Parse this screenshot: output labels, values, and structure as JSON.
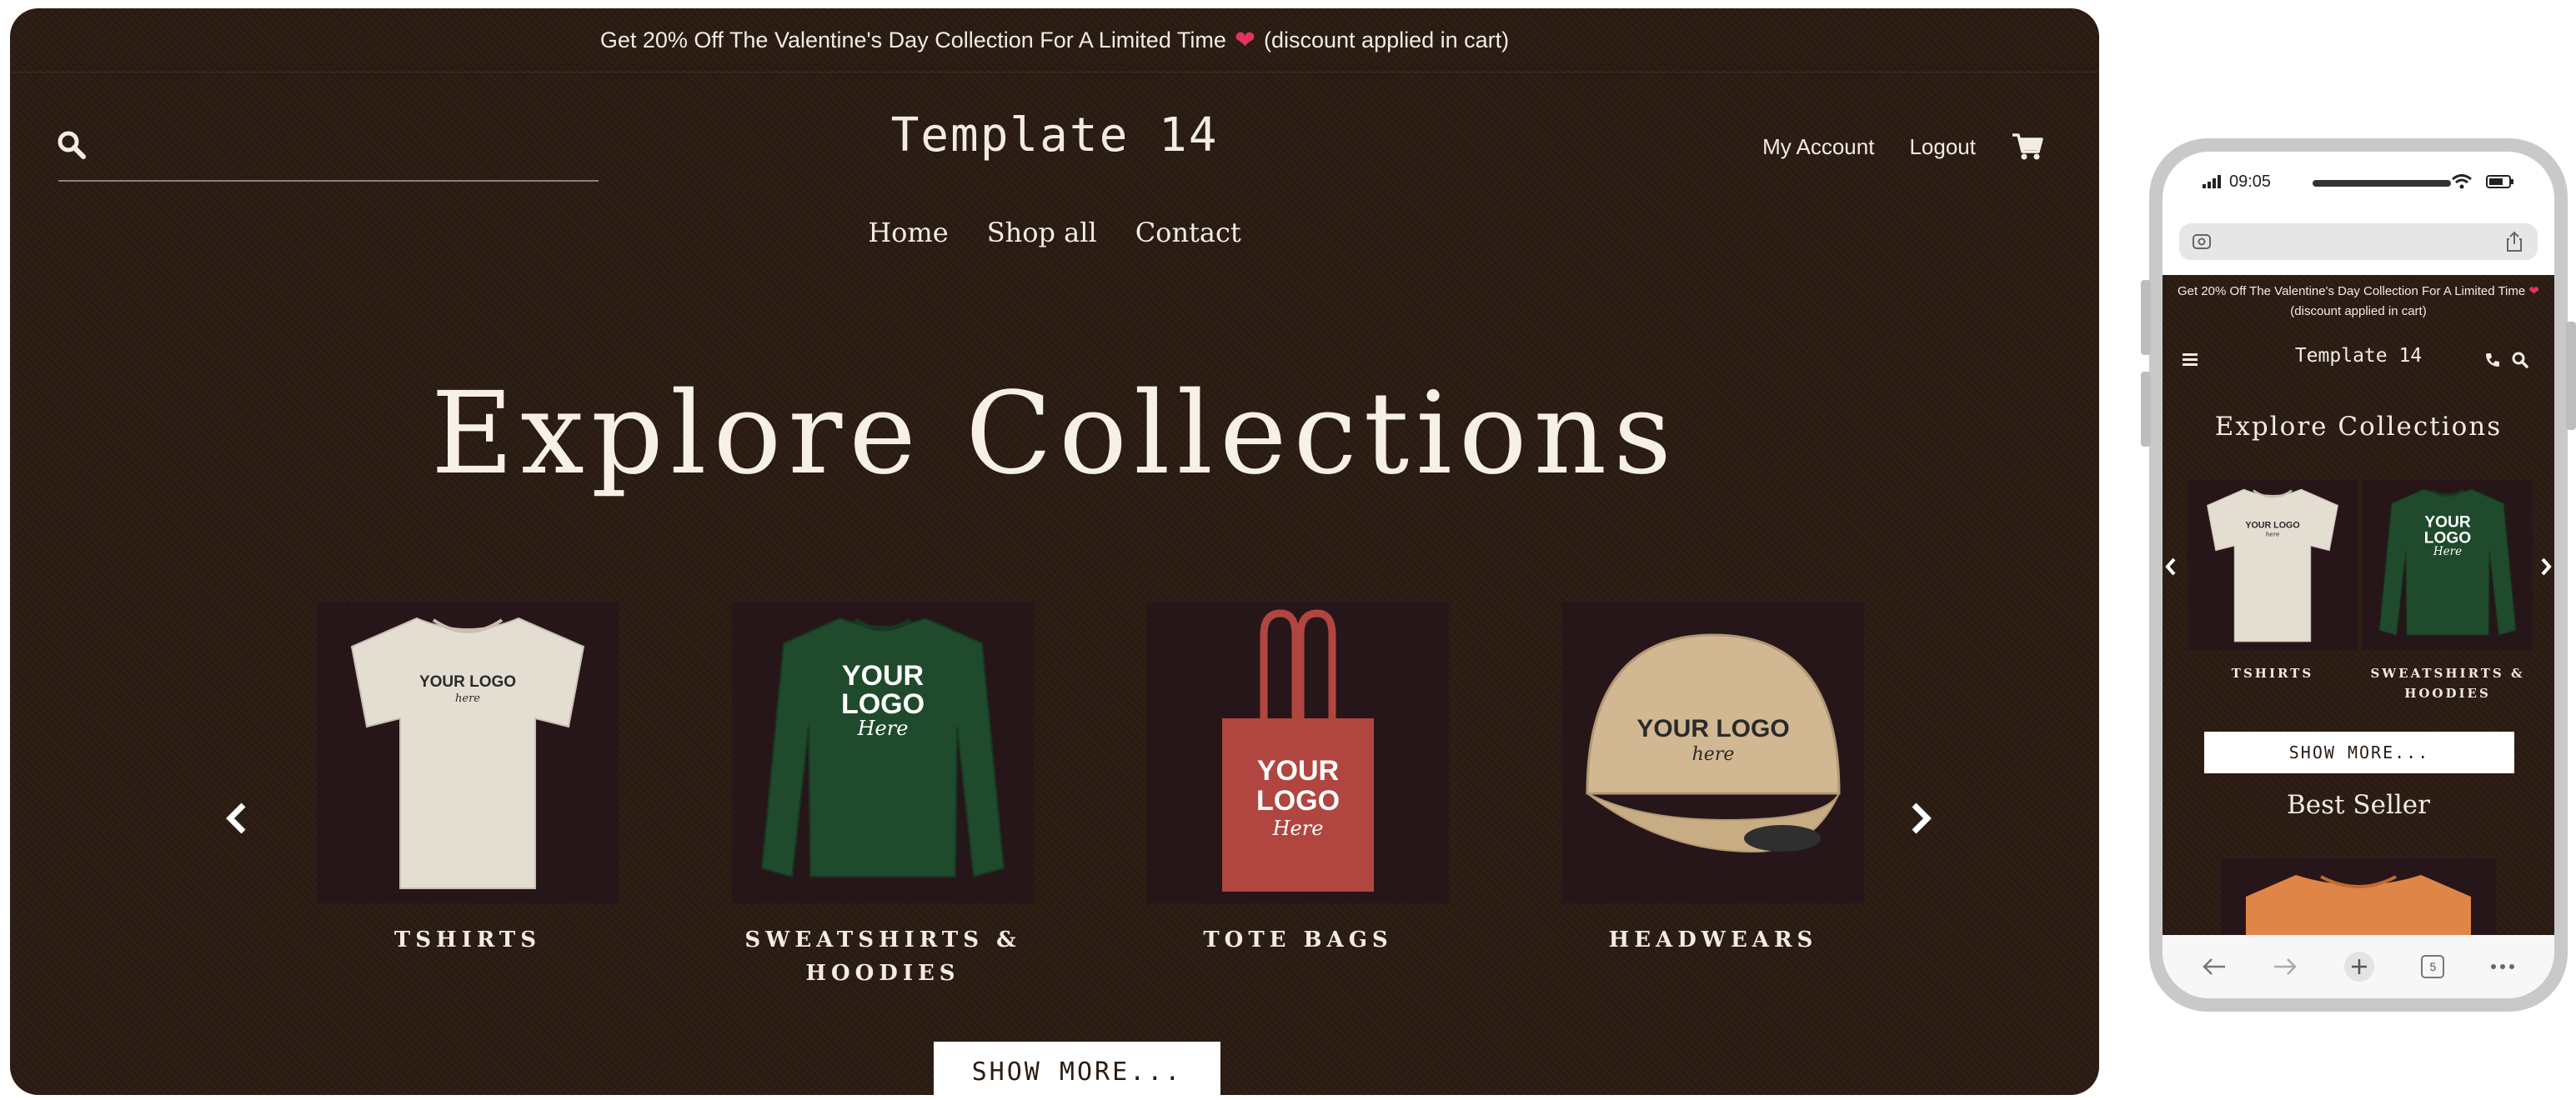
{
  "desktop": {
    "promo": {
      "text_before": "Get 20% Off The Valentine's Day Collection For A Limited Time",
      "text_after": "(discount applied in cart)"
    },
    "logo": "Template 14",
    "account_links": {
      "my_account": "My Account",
      "logout": "Logout"
    },
    "nav": [
      "Home",
      "Shop all",
      "Contact"
    ],
    "hero_title": "Explore Collections",
    "collections": [
      {
        "caption_line1": "TSHIRTS",
        "caption_line2": "",
        "product": "tshirt",
        "print_line1": "YOUR LOGO",
        "print_line2": "here"
      },
      {
        "caption_line1": "SWEATSHIRTS &",
        "caption_line2": "HOODIES",
        "product": "sweatshirt",
        "print_line1": "YOUR",
        "print_line2": "LOGO",
        "print_line3": "Here"
      },
      {
        "caption_line1": "TOTE BAGS",
        "caption_line2": "",
        "product": "tote-bag",
        "print_line1": "YOUR",
        "print_line2": "LOGO",
        "print_line3": "Here"
      },
      {
        "caption_line1": "HEADWEARS",
        "caption_line2": "",
        "product": "cap",
        "print_line1": "YOUR LOGO",
        "print_line2": "here"
      }
    ],
    "show_more": "SHOW MORE..."
  },
  "mobile": {
    "time": "09:05",
    "promo_line1": "Get 20% Off The Valentine's Day Collection For A Limited Time",
    "promo_line2": "(discount applied in cart)",
    "logo": "Template 14",
    "hero_title": "Explore Collections",
    "collections": [
      {
        "caption_line1": "TSHIRTS",
        "caption_line2": ""
      },
      {
        "caption_line1": "SWEATSHIRTS &",
        "caption_line2": "HOODIES"
      }
    ],
    "show_more": "SHOW MORE...",
    "best_seller": "Best Seller",
    "tab_count": "5"
  },
  "colors": {
    "background": "#2a1c12",
    "card_background": "#271619",
    "text": "#f3ece3",
    "heart": "#e2345a",
    "tshirt": "#e4ddd1",
    "sweatshirt": "#1f4a2c",
    "tote": "#b0463f",
    "cap": "#d2b892",
    "best_seller_shirt": "#e08548"
  },
  "icons": [
    "search-icon",
    "cart-icon",
    "heart-icon",
    "arrow-left-icon",
    "arrow-right-icon",
    "menu-icon",
    "phone-icon",
    "share-icon",
    "back-icon",
    "forward-icon",
    "new-tab-icon",
    "tabs-icon",
    "more-icon"
  ]
}
